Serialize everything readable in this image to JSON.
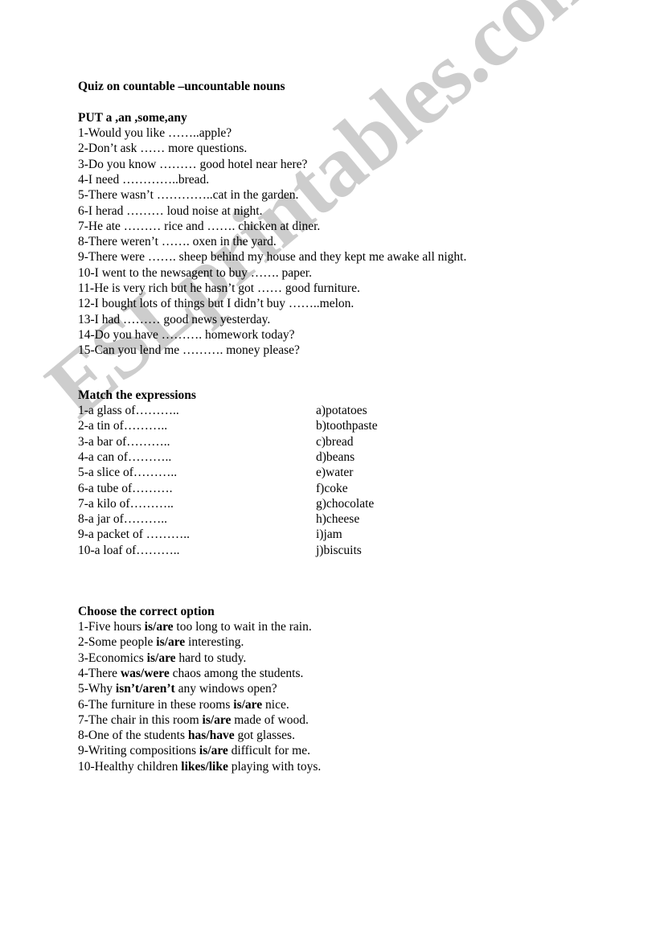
{
  "document": {
    "title": "Quiz on countable –uncountable nouns",
    "watermark": "ESLprintables.com",
    "watermark_color": "#cdcdcd",
    "background_color": "#ffffff",
    "text_color": "#000000"
  },
  "sections": [
    {
      "heading": "PUT a   ,an ,some,any",
      "items": [
        "1-Would you like ……..apple?",
        "2-Don’t ask …… more questions.",
        "3-Do you know ……… good hotel near here?",
        "4-I  need …………..bread.",
        "5-There wasn’t …………..cat in the garden.",
        "6-I herad ……… loud noise at night.",
        "7-He ate ……… rice and ……. chicken at diner.",
        "8-There weren’t ……. oxen  in the yard.",
        "9-There were ……. sheep behind my house  and they kept me awake all night.",
        "10-I went to the newsagent to buy ……. paper.",
        "11-He is very rich but he  hasn’t got …… good furniture.",
        "12-I bought  lots of things but I didn’t buy ……..melon.",
        "13-I had ……… good news yesterday.",
        "14-Do you have ………. homework today?",
        "15-Can you lend me ………. money please?"
      ]
    },
    {
      "heading": "Match the expressions",
      "items": [
        "1-a glass of………..",
        "2-a tin of………..",
        "3-a bar of………..",
        "4-a can of………..",
        "5-a slice of………..",
        "6-a tube of……….",
        "7-a kilo of………..",
        "8-a jar of………..",
        "9-a packet of  ………..",
        "10-a loaf of……….."
      ],
      "options": [
        "a)potatoes",
        "b)toothpaste",
        "c)bread",
        "d)beans",
        "e)water",
        "f)coke",
        "g)chocolate",
        "h)cheese",
        "i)jam",
        "j)biscuits"
      ]
    },
    {
      "heading": "Choose the correct option",
      "items": [
        {
          "before": "1-Five hours  ",
          "choice": "is/are",
          "after": "  too long to wait in the rain."
        },
        {
          "before": "2-Some people  ",
          "choice": "is/are",
          "after": "   interesting."
        },
        {
          "before": "3-Economics   ",
          "choice": "is/are",
          "after": "   hard to study."
        },
        {
          "before": "4-There  ",
          "choice": "was/were",
          "after": "  chaos among the students."
        },
        {
          "before": "5-Why  ",
          "choice": "isn’t/aren’t",
          "after": "  any windows open?"
        },
        {
          "before": "6-The furniture in these rooms   ",
          "choice": "is/are",
          "after": "  nice."
        },
        {
          "before": "7-The chair in this room  ",
          "choice": "is/are",
          "after": "  made of wood."
        },
        {
          "before": "8-One of the students  ",
          "choice": "has/have",
          "after": "   got glasses."
        },
        {
          "before": "9-Writing compositions  ",
          "choice": "is/are",
          "after": "  difficult for me."
        },
        {
          "before": "10-Healthy children  ",
          "choice": "likes/like",
          "after": "  playing with toys."
        }
      ]
    }
  ]
}
